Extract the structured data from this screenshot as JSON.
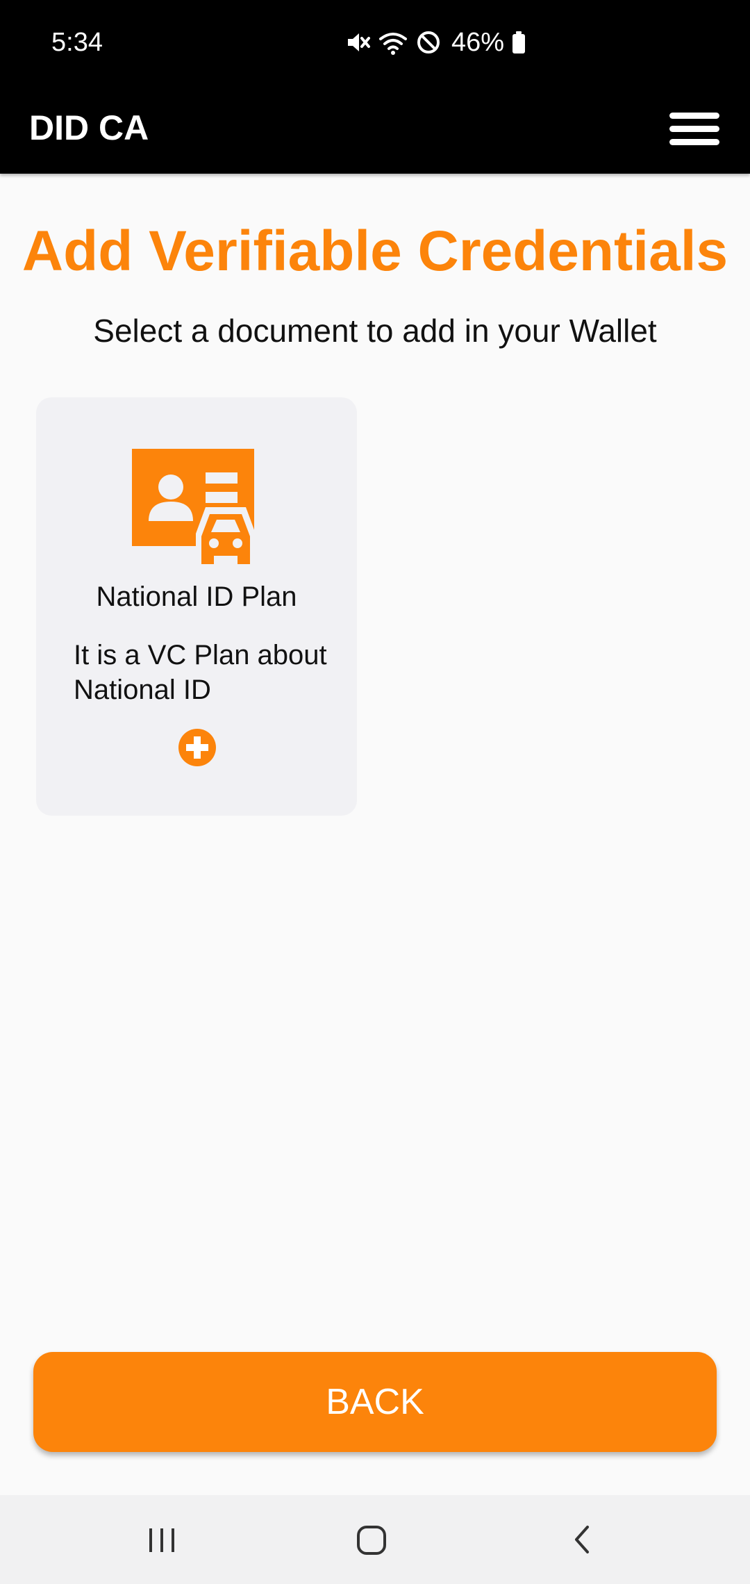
{
  "status_bar": {
    "time": "5:34",
    "battery": "46%",
    "icons": [
      "mute-icon",
      "wifi-icon",
      "do-not-disturb-icon",
      "battery-icon"
    ]
  },
  "app_bar": {
    "title": "DID CA",
    "menu_icon": "hamburger-menu-icon"
  },
  "page": {
    "heading": "Add Verifiable Credentials",
    "subheading": "Select a document to add in your Wallet"
  },
  "credential_plans": [
    {
      "title": "National ID Plan",
      "description": "It is a VC Plan about National ID",
      "icon": "id-card-car-icon",
      "add_icon": "add-circle-icon"
    }
  ],
  "back_button": {
    "label": "BACK"
  },
  "navigation_bar": {
    "buttons": [
      "recent-apps-icon",
      "home-icon",
      "back-icon"
    ]
  },
  "colors": {
    "accent": "#fc840b",
    "app_bar": "#000000",
    "background": "#fafafa",
    "card": "#f1f1f4"
  }
}
